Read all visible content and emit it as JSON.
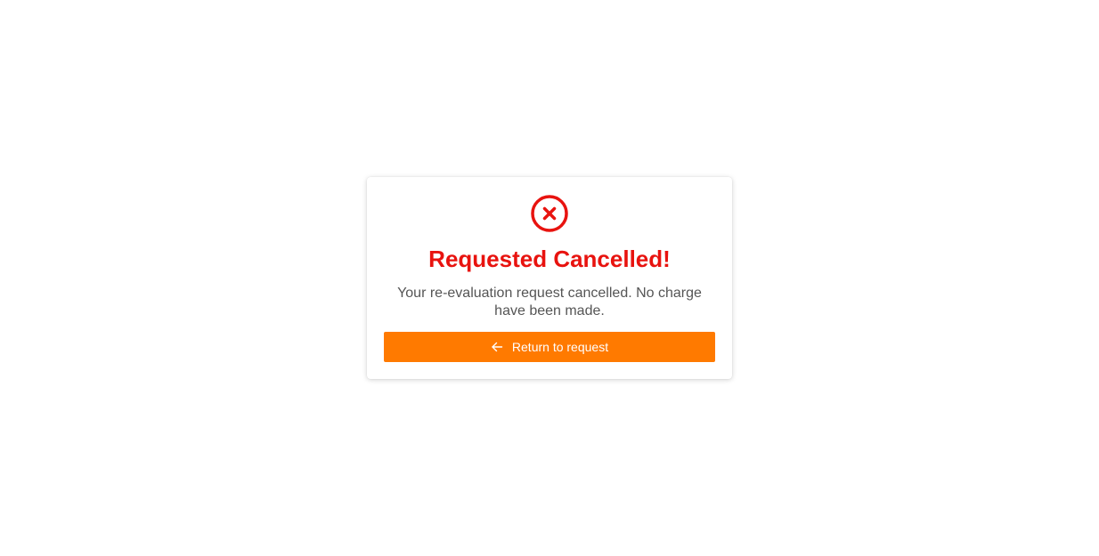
{
  "dialog": {
    "icon": "circle-x-icon",
    "title": "Requested Cancelled!",
    "message": "Your re-evaluation request cancelled. No charge have been made.",
    "button": {
      "label": "Return to request",
      "icon": "arrow-left-icon"
    }
  },
  "colors": {
    "error": "#e8130f",
    "message_text": "#555555",
    "button_bg": "#ff7a00",
    "button_text": "#ffffff"
  }
}
